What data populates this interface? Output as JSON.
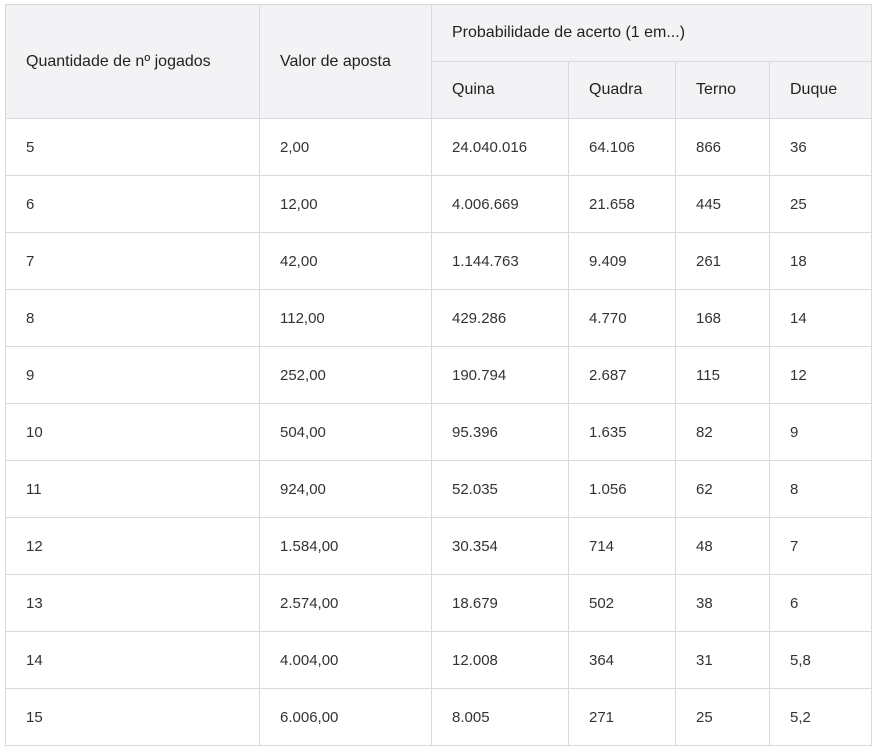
{
  "table": {
    "headers": {
      "quantidade": "Quantidade de nº jogados",
      "valor": "Valor de aposta",
      "probabilidade": "Probabilidade de acerto (1 em...)",
      "quina": "Quina",
      "quadra": "Quadra",
      "terno": "Terno",
      "duque": "Duque"
    },
    "rows": [
      [
        "5",
        "2,00",
        "24.040.016",
        "64.106",
        "866",
        "36"
      ],
      [
        "6",
        "12,00",
        "4.006.669",
        "21.658",
        "445",
        "25"
      ],
      [
        "7",
        "42,00",
        "1.144.763",
        "9.409",
        "261",
        "18"
      ],
      [
        "8",
        "112,00",
        "429.286",
        "4.770",
        "168",
        "14"
      ],
      [
        "9",
        "252,00",
        "190.794",
        "2.687",
        "115",
        "12"
      ],
      [
        "10",
        "504,00",
        "95.396",
        "1.635",
        "82",
        "9"
      ],
      [
        "11",
        "924,00",
        "52.035",
        "1.056",
        "62",
        "8"
      ],
      [
        "12",
        "1.584,00",
        "30.354",
        "714",
        "48",
        "7"
      ],
      [
        "13",
        "2.574,00",
        "18.679",
        "502",
        "38",
        "6"
      ],
      [
        "14",
        "4.004,00",
        "12.008",
        "364",
        "31",
        "5,8"
      ],
      [
        "15",
        "6.006,00",
        "8.005",
        "271",
        "25",
        "5,2"
      ]
    ]
  }
}
